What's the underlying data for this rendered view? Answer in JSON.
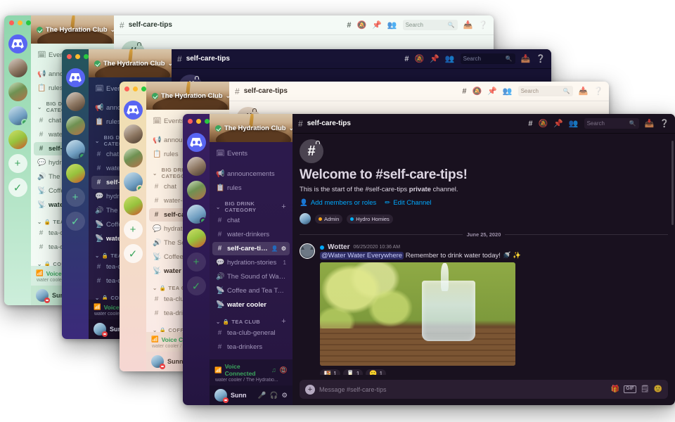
{
  "app": {
    "name": "Discord",
    "server_name": "The Hydration Club"
  },
  "windows": [
    {
      "theme": "mint",
      "theme_label": "Mint Apple"
    },
    {
      "theme": "teal",
      "theme_label": "Dusk"
    },
    {
      "theme": "cream",
      "theme_label": "Sunrise"
    },
    {
      "theme": "dark",
      "theme_label": "Dark"
    }
  ],
  "sidebar": {
    "server_header": {
      "name": "The Hydration Club",
      "verified": true,
      "chevron": "chevron-down-icon"
    },
    "top_items": [
      {
        "icon": "calendar-icon",
        "label": "Events"
      },
      {
        "icon": "megaphone-icon",
        "label": "announcements"
      },
      {
        "icon": "book-icon",
        "label": "rules"
      }
    ],
    "categories": [
      {
        "label": "BIG DRINK CATEGORY",
        "add_label": "+",
        "channels": [
          {
            "icon": "hash-icon",
            "label": "chat",
            "state": "normal"
          },
          {
            "icon": "hash-icon",
            "label": "water-drinkers",
            "state": "normal"
          },
          {
            "icon": "hash-lock-icon",
            "label": "self-care-tips",
            "state": "active",
            "tail_icons": [
              "add-member-icon",
              "gear-icon"
            ]
          },
          {
            "icon": "forum-icon",
            "label": "hydration-stories",
            "state": "normal",
            "badge": "1"
          },
          {
            "icon": "speaker-icon",
            "label": "The Sound of Water",
            "state": "normal"
          },
          {
            "icon": "stage-icon",
            "label": "Coffee and Tea Talks",
            "state": "normal"
          },
          {
            "icon": "stage-icon",
            "label": "water cooler",
            "state": "unread"
          }
        ]
      },
      {
        "label": "TEA CLUB",
        "add_label": "+",
        "channels": [
          {
            "icon": "hash-icon",
            "label": "tea-club-general",
            "state": "normal"
          },
          {
            "icon": "hash-icon",
            "label": "tea-drinkers",
            "state": "normal"
          }
        ]
      },
      {
        "label": "COFFEE CLUB",
        "add_label": "+",
        "channels": []
      }
    ],
    "voice": {
      "status": "Voice Connected",
      "detail": "water cooler / The Hydratio...",
      "icons": [
        "noise-suppression-icon",
        "disconnect-call-icon"
      ]
    },
    "user": {
      "name": "Sunn",
      "status": "dnd",
      "icons": [
        "mic-muted-icon",
        "headphones-icon",
        "settings-gear-icon"
      ]
    }
  },
  "servers": [
    {
      "name": "discord-home",
      "kind": "discord"
    },
    {
      "name": "coffee-server",
      "kind": "coffee"
    },
    {
      "name": "plant-server",
      "kind": "plant"
    },
    {
      "name": "sink-server",
      "kind": "sink",
      "online": true
    },
    {
      "name": "yellow-server",
      "kind": "yellow"
    },
    {
      "name": "add-server",
      "kind": "action",
      "glyph": "+"
    },
    {
      "name": "explore-servers",
      "kind": "action",
      "glyph": "✓"
    }
  ],
  "topbar": {
    "channel_icon": "hash-lock-icon",
    "channel_name": "self-care-tips",
    "tools": [
      "threads-icon",
      "notification-off-icon",
      "pin-icon",
      "members-icon"
    ],
    "search": {
      "placeholder": "Search",
      "icon": "search-icon"
    },
    "inbox_icon": "inbox-icon",
    "help_icon": "help-icon"
  },
  "welcome": {
    "icon": "hash-lock-icon",
    "title": "Welcome to #self-care-tips!",
    "subtitle_pre": "This is the start of the ",
    "subtitle_channel": "#self-care-tips",
    "subtitle_bold": " private",
    "subtitle_post": " channel.",
    "actions": [
      {
        "icon": "add-member-icon",
        "label": "Add members or roles"
      },
      {
        "icon": "pencil-icon",
        "label": "Edit Channel"
      }
    ],
    "roles": [
      {
        "label": "Admin",
        "color": "#faa61a"
      },
      {
        "label": "Hydro Homies",
        "color": "#00b0f4"
      }
    ]
  },
  "date_divider": "June 25, 2020",
  "message": {
    "author": "Wotter",
    "status_dot_color": "#00a8fc",
    "timestamp": "06/25/2020 10:36 AM",
    "mention": "@Water Water Everywhere",
    "text": " Remember to drink water today! 🚿 ✨",
    "attachment_alt": "glass-of-water-photo",
    "reactions": [
      {
        "emoji": "🍱",
        "count": "1"
      },
      {
        "emoji": "🥛",
        "count": "1"
      },
      {
        "emoji": "🙂",
        "count": "1"
      }
    ]
  },
  "composer": {
    "plus_label": "+",
    "placeholder": "Message #self-care-tips",
    "icons": [
      "gift-icon",
      "gif-icon",
      "sticker-icon",
      "emoji-icon"
    ],
    "gif_label": "GIF"
  }
}
